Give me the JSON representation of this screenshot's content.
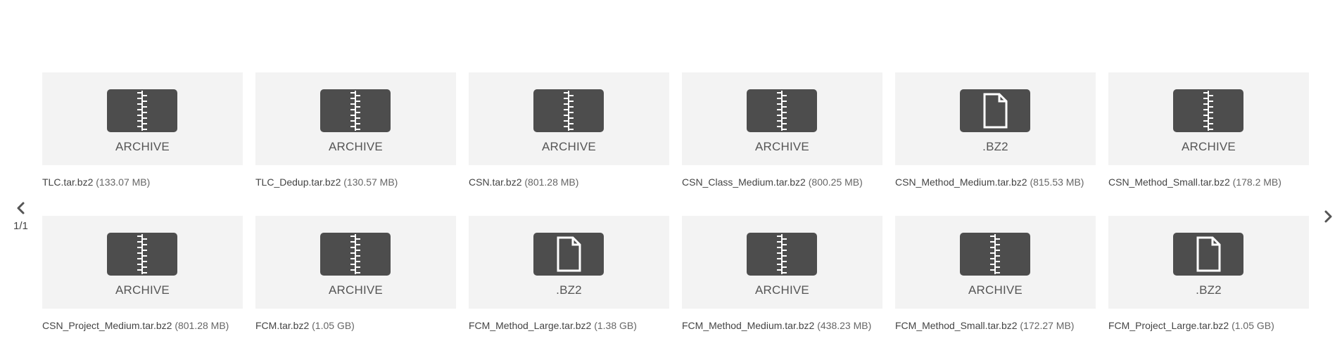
{
  "pager": {
    "counter": "1/1",
    "prev_icon": "chevron-left-icon",
    "next_icon": "chevron-right-icon"
  },
  "files": [
    {
      "name": "TLC.tar.bz2",
      "size": "(133.07 MB)",
      "type": "ARCHIVE",
      "icon": "archive-zip-icon"
    },
    {
      "name": "TLC_Dedup.tar.bz2",
      "size": "(130.57 MB)",
      "type": "ARCHIVE",
      "icon": "archive-zip-icon"
    },
    {
      "name": "CSN.tar.bz2",
      "size": "(801.28 MB)",
      "type": "ARCHIVE",
      "icon": "archive-zip-icon"
    },
    {
      "name": "CSN_Class_Medium.tar.bz2",
      "size": "(800.25 MB)",
      "type": "ARCHIVE",
      "icon": "archive-zip-icon"
    },
    {
      "name": "CSN_Method_Medium.tar.bz2",
      "size": "(815.53 MB)",
      "type": ".BZ2",
      "icon": "document-icon"
    },
    {
      "name": "CSN_Method_Small.tar.bz2",
      "size": "(178.2 MB)",
      "type": "ARCHIVE",
      "icon": "archive-zip-icon"
    },
    {
      "name": "CSN_Project_Medium.tar.bz2",
      "size": "(801.28 MB)",
      "type": "ARCHIVE",
      "icon": "archive-zip-icon"
    },
    {
      "name": "FCM.tar.bz2",
      "size": "(1.05 GB)",
      "type": "ARCHIVE",
      "icon": "archive-zip-icon"
    },
    {
      "name": "FCM_Method_Large.tar.bz2",
      "size": "(1.38 GB)",
      "type": ".BZ2",
      "icon": "document-icon"
    },
    {
      "name": "FCM_Method_Medium.tar.bz2",
      "size": "(438.23 MB)",
      "type": "ARCHIVE",
      "icon": "archive-zip-icon"
    },
    {
      "name": "FCM_Method_Small.tar.bz2",
      "size": "(172.27 MB)",
      "type": "ARCHIVE",
      "icon": "archive-zip-icon"
    },
    {
      "name": "FCM_Project_Large.tar.bz2",
      "size": "(1.05 GB)",
      "type": ".BZ2",
      "icon": "document-icon"
    }
  ],
  "colors": {
    "tile_background": "#f3f3f3",
    "icon_background": "#4d4d4d",
    "text": "#555555"
  }
}
